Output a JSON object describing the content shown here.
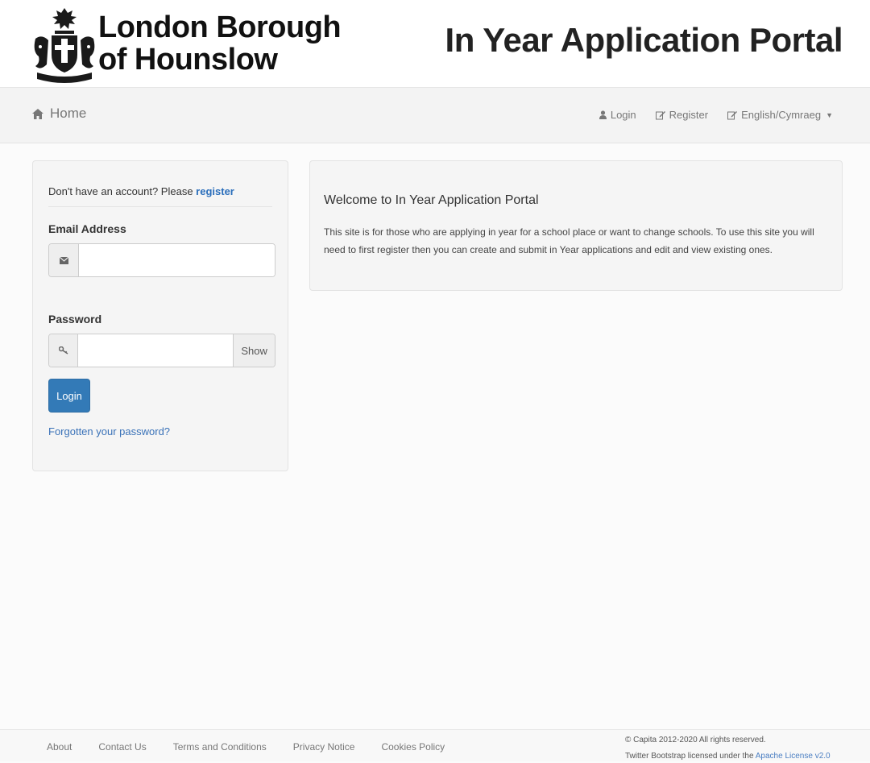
{
  "header": {
    "brand_line1": "London Borough",
    "brand_line2": "of Hounslow",
    "portal_title": "In Year Application Portal"
  },
  "navbar": {
    "home": "Home",
    "login": "Login",
    "register": "Register",
    "language": "English/Cymraeg"
  },
  "login": {
    "signup_prompt": "Don't have an account? Please ",
    "signup_link": "register",
    "email_label": "Email Address",
    "email_value": "",
    "password_label": "Password",
    "password_value": "",
    "show_label": "Show",
    "login_button": "Login",
    "forgot_link": "Forgotten your password?"
  },
  "welcome": {
    "title": "Welcome to In Year Application Portal",
    "body": "This site is for those who are applying in year for a school place or want to change schools. To use this site you will need to first register then you can create and submit in Year applications and edit and view existing ones."
  },
  "footer": {
    "links": [
      "About",
      "Contact Us",
      "Terms and Conditions",
      "Privacy Notice",
      "Cookies Policy"
    ],
    "copyright": "© Capita 2012-2020 All rights reserved.",
    "license_prefix": "Twitter Bootstrap licensed under the ",
    "license_link": "Apache License v2.0"
  },
  "colors": {
    "primary": "#337ab7",
    "link": "#2a6ebb"
  },
  "icons": [
    "crest-logo",
    "home-icon",
    "user-icon",
    "edit-icon",
    "envelope-icon",
    "key-icon",
    "caret-down-icon"
  ]
}
